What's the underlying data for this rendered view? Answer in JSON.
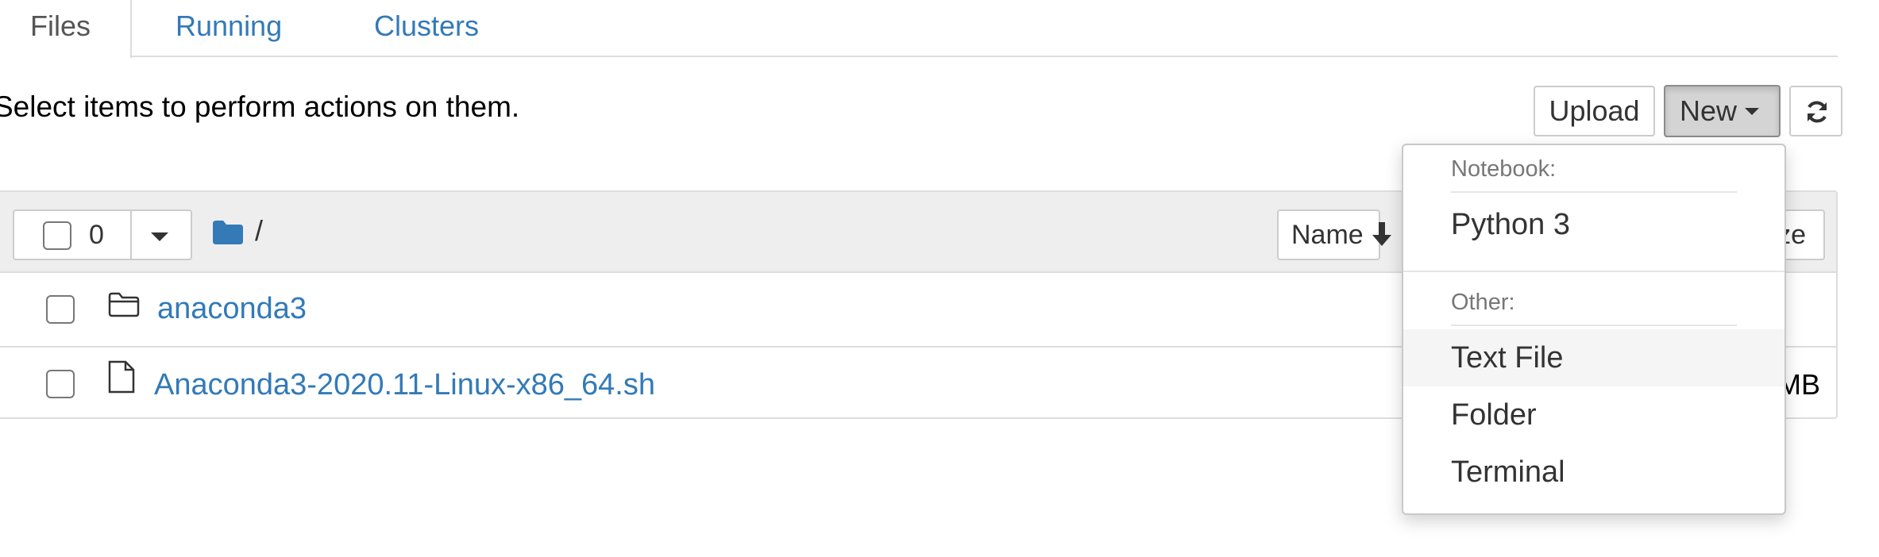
{
  "tabs": [
    {
      "label": "Files",
      "active": true
    },
    {
      "label": "Running",
      "active": false
    },
    {
      "label": "Clusters",
      "active": false
    }
  ],
  "instruction": "Select items to perform actions on them.",
  "toolbar": {
    "upload_label": "Upload",
    "new_label": "New",
    "refresh_icon": "refresh-icon"
  },
  "list_header": {
    "selected_count": "0",
    "breadcrumb_root": "/",
    "sort_name_label": "Name",
    "sort_size_label": "Size"
  },
  "files": [
    {
      "name": "anaconda3",
      "type": "folder",
      "size": ""
    },
    {
      "name": "Anaconda3-2020.11-Linux-x86_64.sh",
      "type": "file",
      "size": "MB"
    }
  ],
  "new_menu": {
    "notebook_header": "Notebook:",
    "notebook_items": [
      "Python 3"
    ],
    "other_header": "Other:",
    "other_items": [
      "Text File",
      "Folder",
      "Terminal"
    ]
  },
  "colors": {
    "link": "#337ab7",
    "active_button_bg": "#d4d4d4",
    "header_bg": "#eeeeee",
    "border": "#dddddd"
  }
}
